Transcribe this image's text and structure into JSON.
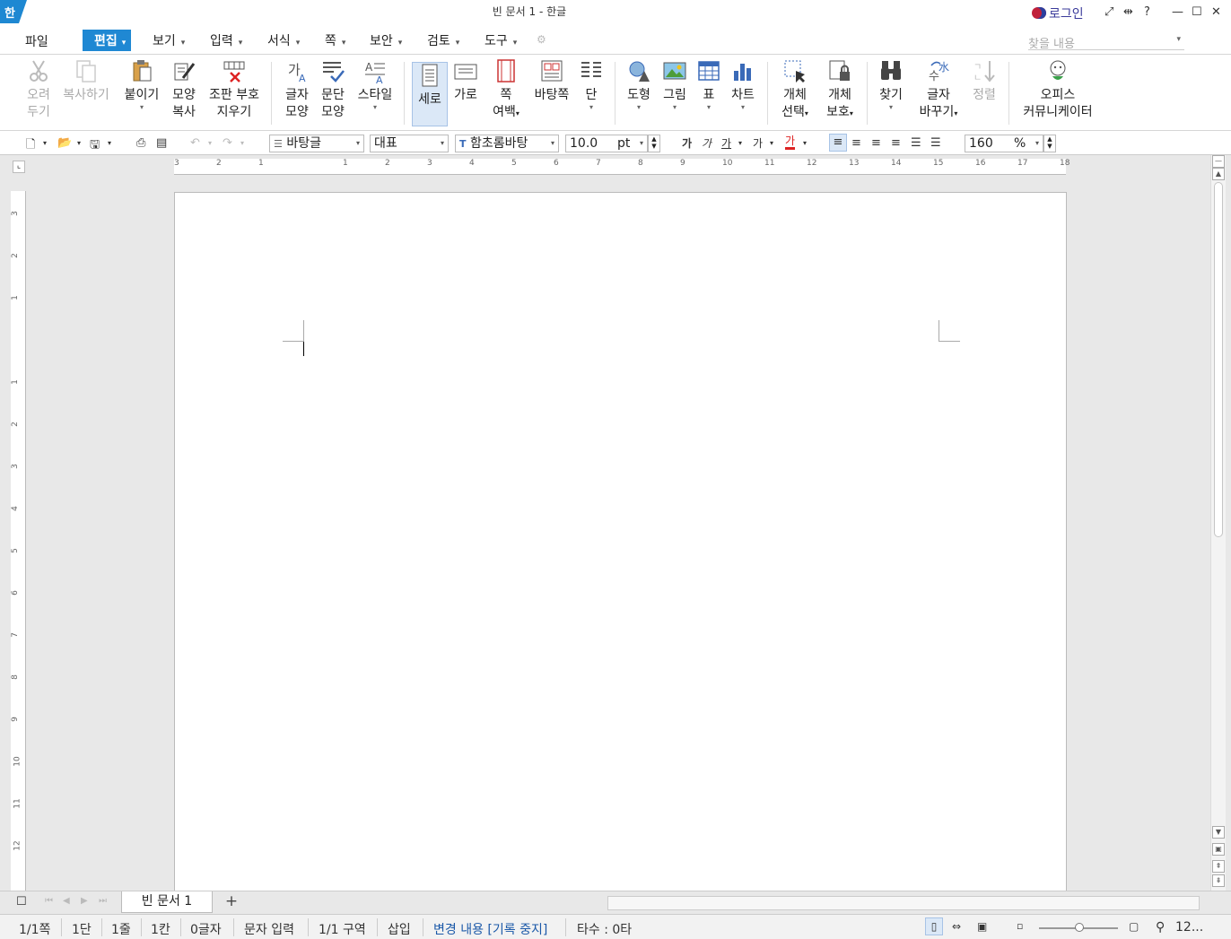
{
  "titlebar": {
    "app_icon": "한",
    "title": "빈 문서 1 - 한글",
    "login": "로그인",
    "help": "?"
  },
  "menu": {
    "file": "파일",
    "edit": "편집",
    "view": "보기",
    "insert": "입력",
    "format": "서식",
    "page": "쪽",
    "security": "보안",
    "review": "검토",
    "tools": "도구",
    "find_placeholder": "찾을 내용"
  },
  "ribbon": {
    "cut": [
      "오려",
      "두기"
    ],
    "copy": "복사하기",
    "paste": "붙이기",
    "format_copy": [
      "모양",
      "복사"
    ],
    "clear_marks": [
      "조판 부호",
      "지우기"
    ],
    "char_shape": [
      "글자",
      "모양"
    ],
    "para_shape": [
      "문단",
      "모양"
    ],
    "style": "스타일",
    "portrait": "세로",
    "landscape": "가로",
    "page_margin": [
      "쪽",
      "여백"
    ],
    "background_page": "바탕쪽",
    "columns": "단",
    "shape": "도형",
    "picture": "그림",
    "table": "표",
    "chart": "차트",
    "object_select": [
      "개체",
      "선택"
    ],
    "object_protect": [
      "개체",
      "보호"
    ],
    "find": "찾기",
    "replace_char": [
      "글자",
      "바꾸기"
    ],
    "sort": "정렬",
    "office_comm": [
      "오피스",
      "커뮤니케이터"
    ]
  },
  "format_toolbar": {
    "style": "바탕글",
    "language": "대표",
    "font": "함초롬바탕",
    "font_size": "10.0",
    "size_unit": "pt",
    "bold": "가",
    "italic": "가",
    "underline": "가",
    "strike": "가",
    "font_color": "가",
    "zoom": "160",
    "zoom_unit": "%"
  },
  "hruler_labels": [
    "3",
    "2",
    "1",
    "",
    "1",
    "2",
    "3",
    "4",
    "5",
    "6",
    "7",
    "8",
    "9",
    "10",
    "11",
    "12",
    "13",
    "14",
    "15",
    "16",
    "17",
    "18"
  ],
  "vruler_labels": [
    "3",
    "2",
    "1",
    "",
    "1",
    "2",
    "3",
    "4",
    "5",
    "6",
    "7",
    "8",
    "9",
    "10",
    "11",
    "12"
  ],
  "tabs": {
    "doc_tab": "빈 문서 1",
    "add": "+"
  },
  "status": {
    "page": "1/1쪽",
    "column": "1단",
    "line": "1줄",
    "cell": "1칸",
    "chars": "0글자",
    "mode": "문자 입력",
    "section": "1/1 구역",
    "insert": "삽입",
    "track_changes": "변경 내용 [기록 중지]",
    "typing": "타수 : 0타",
    "zoom": "12..."
  },
  "colors": {
    "accent": "#1f88d3",
    "track_changes_text": "#1a58a8"
  }
}
